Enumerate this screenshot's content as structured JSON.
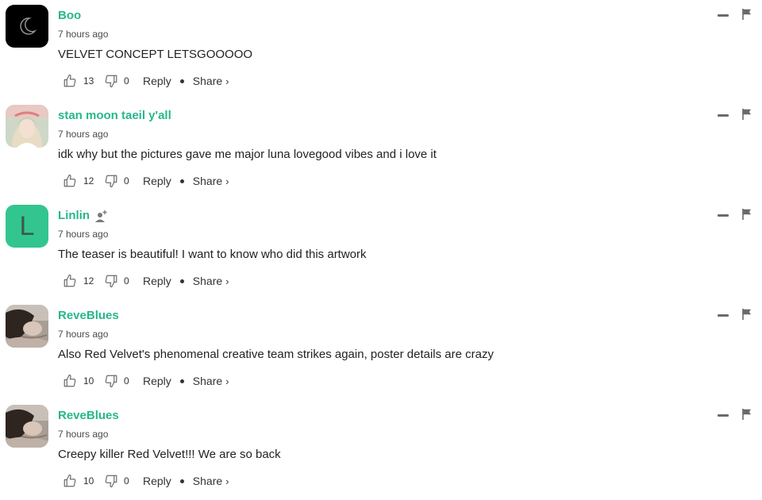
{
  "labels": {
    "reply": "Reply",
    "share": "Share",
    "share_chevron": "›"
  },
  "colors": {
    "username": "#27b78b",
    "text": "#222222",
    "icon": "#6b6b6b"
  },
  "comments": [
    {
      "avatar": {
        "type": "moon",
        "background": "#000000"
      },
      "username": "Boo",
      "has_follow_icon": false,
      "timestamp": "7 hours ago",
      "text": "VELVET CONCEPT LETSGOOOOO",
      "likes": "13",
      "dislikes": "0"
    },
    {
      "avatar": {
        "type": "photo-girl",
        "background": "#cfd8c8"
      },
      "username": "stan moon taeil y'all",
      "has_follow_icon": false,
      "timestamp": "7 hours ago",
      "text": "idk why but the pictures gave me major luna lovegood vibes and i love it",
      "likes": "12",
      "dislikes": "0"
    },
    {
      "avatar": {
        "type": "letter",
        "letter": "L",
        "background": "#33c58f",
        "letter_color": "#3a5a4d"
      },
      "username": "Linlin",
      "has_follow_icon": true,
      "follow_icon": "add-person-icon",
      "timestamp": "7 hours ago",
      "text": "The teaser is beautiful! I want to know who did this artwork",
      "likes": "12",
      "dislikes": "0"
    },
    {
      "avatar": {
        "type": "photo-dark-hair",
        "background": "#a89e95"
      },
      "username": "ReveBlues",
      "has_follow_icon": false,
      "timestamp": "7 hours ago",
      "text": "Also Red Velvet's phenomenal creative team strikes again, poster details are crazy",
      "likes": "10",
      "dislikes": "0"
    },
    {
      "avatar": {
        "type": "photo-dark-hair",
        "background": "#a89e95"
      },
      "username": "ReveBlues",
      "has_follow_icon": false,
      "timestamp": "7 hours ago",
      "text": "Creepy killer Red Velvet!!! We are so back",
      "likes": "10",
      "dislikes": "0"
    }
  ]
}
